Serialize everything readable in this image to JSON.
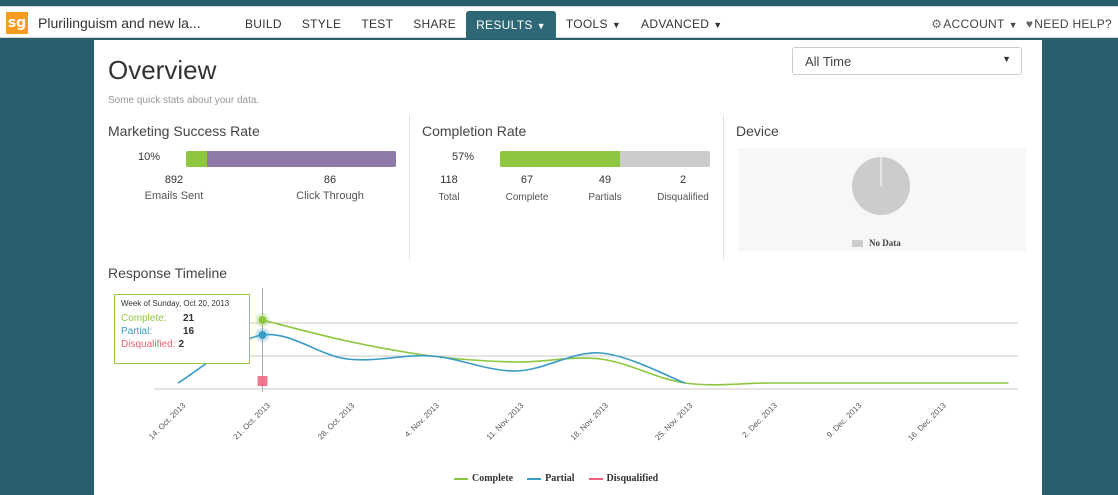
{
  "app": {
    "logo": "sg",
    "survey_title": "Plurilinguism and new la..."
  },
  "nav": {
    "items": [
      "BUILD",
      "STYLE",
      "TEST",
      "SHARE"
    ],
    "results": "RESULTS",
    "tools": "TOOLS",
    "advanced": "ADVANCED",
    "account": "ACCOUNT",
    "help": "NEED HELP?"
  },
  "overview": {
    "title": "Overview",
    "subtitle": "Some quick stats about your data.",
    "time_filter": "All Time"
  },
  "marketing": {
    "title": "Marketing Success Rate",
    "percent_label": "10%",
    "fraction": 0.1,
    "emails_sent": "892",
    "emails_sent_label": "Emails Sent",
    "click_through": "86",
    "click_through_label": "Click Through",
    "colors": {
      "done": "#8dc63f",
      "rest": "#8e79a8"
    }
  },
  "completion": {
    "title": "Completion Rate",
    "percent_label": "57%",
    "fraction": 0.57,
    "total": "118",
    "total_label": "Total",
    "complete": "67",
    "complete_label": "Complete",
    "partials": "49",
    "partials_label": "Partials",
    "disqualified": "2",
    "disqualified_label": "Disqualified",
    "colors": {
      "done": "#8dc63f",
      "rest": "#cccccc"
    }
  },
  "device": {
    "title": "Device",
    "no_data": "No Data"
  },
  "timeline": {
    "title": "Response Timeline",
    "tooltip": {
      "header": "Week of Sunday, Oct 20, 2013",
      "complete_label": "Complete:",
      "complete": "21",
      "partial_label": "Partial:",
      "partial": "16",
      "disqualified_label": "Disqualified:",
      "disqualified": "2"
    }
  },
  "chart_data": {
    "type": "line",
    "categories": [
      "14. Oct. 2013",
      "21. Oct. 2013",
      "28. Oct. 2013",
      "4. Nov. 2013",
      "11. Nov. 2013",
      "18. Nov. 2013",
      "25. Nov. 2013",
      "2. Dec. 2013",
      "9. Dec. 2013",
      "16. Dec. 2013"
    ],
    "series": [
      {
        "name": "Complete",
        "color": "#8dc63f",
        "values": [
          null,
          21,
          14,
          9,
          7,
          8,
          0,
          0,
          0,
          0
        ]
      },
      {
        "name": "Partial",
        "color": "#3a9cc6",
        "values": [
          0,
          16,
          8,
          9,
          4,
          10,
          0,
          null,
          null,
          null
        ]
      },
      {
        "name": "Disqualified",
        "color": "#ee5f7b",
        "values": [
          null,
          2,
          null,
          null,
          null,
          null,
          null,
          null,
          null,
          null
        ]
      }
    ],
    "ylim": [
      0,
      21
    ]
  }
}
